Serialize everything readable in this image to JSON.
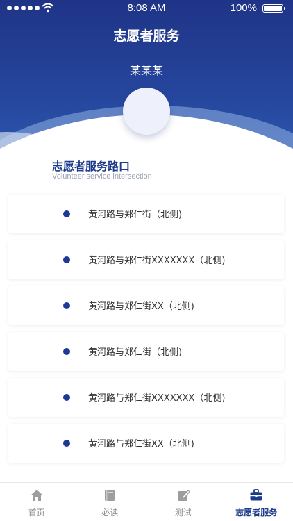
{
  "status_bar": {
    "time": "8:08 AM",
    "battery": "100%"
  },
  "header": {
    "title": "志愿者服务",
    "user_name": "某某某"
  },
  "section": {
    "title": "志愿者服务路口",
    "subtitle": "Volunteer service intersection"
  },
  "intersections": [
    {
      "label": "黄河路与郑仁街（北侧)"
    },
    {
      "label": "黄河路与郑仁街XXXXXXX（北侧)"
    },
    {
      "label": "黄河路与郑仁街XX（北侧)"
    },
    {
      "label": "黄河路与郑仁街（北侧)"
    },
    {
      "label": "黄河路与郑仁街XXXXXXX（北侧)"
    },
    {
      "label": "黄河路与郑仁街XX（北侧)"
    }
  ],
  "tabs": [
    {
      "label": "首页",
      "icon": "home-icon"
    },
    {
      "label": "必读",
      "icon": "book-icon"
    },
    {
      "label": "测试",
      "icon": "edit-icon"
    },
    {
      "label": "志愿者服务",
      "icon": "briefcase-icon",
      "active": true
    }
  ],
  "colors": {
    "primary": "#1e3a8a",
    "header_top": "#1f3487",
    "header_bottom": "#3263b8",
    "inactive_tab": "#9e9e9e"
  }
}
